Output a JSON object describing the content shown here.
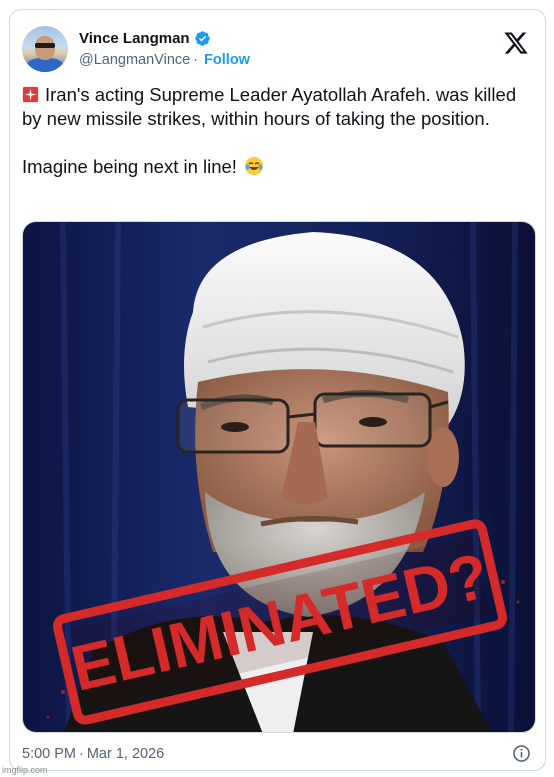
{
  "author": {
    "display_name": "Vince Langman",
    "handle": "@LangmanVince",
    "separator": "·",
    "follow_label": "Follow",
    "verified": true
  },
  "tweet": {
    "line1": "Iran's acting Supreme Leader Ayatollah Arafeh. was killed by new missile strikes, within hours of taking the position.",
    "line2": "Imagine being next in line!",
    "emoji_start": "rotating-light-emoji",
    "emoji_end": "tears-of-joy-emoji"
  },
  "media": {
    "stamp_text": "ELIMINATED?",
    "stamp_color": "#d42a2a",
    "description_icon": "portrait-photo"
  },
  "footer": {
    "time": "5:00 PM",
    "separator": "·",
    "date": "Mar 1, 2026"
  },
  "watermark": "imgflip.com",
  "colors": {
    "link": "#1d9bf0",
    "muted": "#536471",
    "text": "#0f1419",
    "border": "#cfd9de"
  },
  "icons": [
    "verified-badge-icon",
    "x-logo-icon",
    "info-icon"
  ]
}
